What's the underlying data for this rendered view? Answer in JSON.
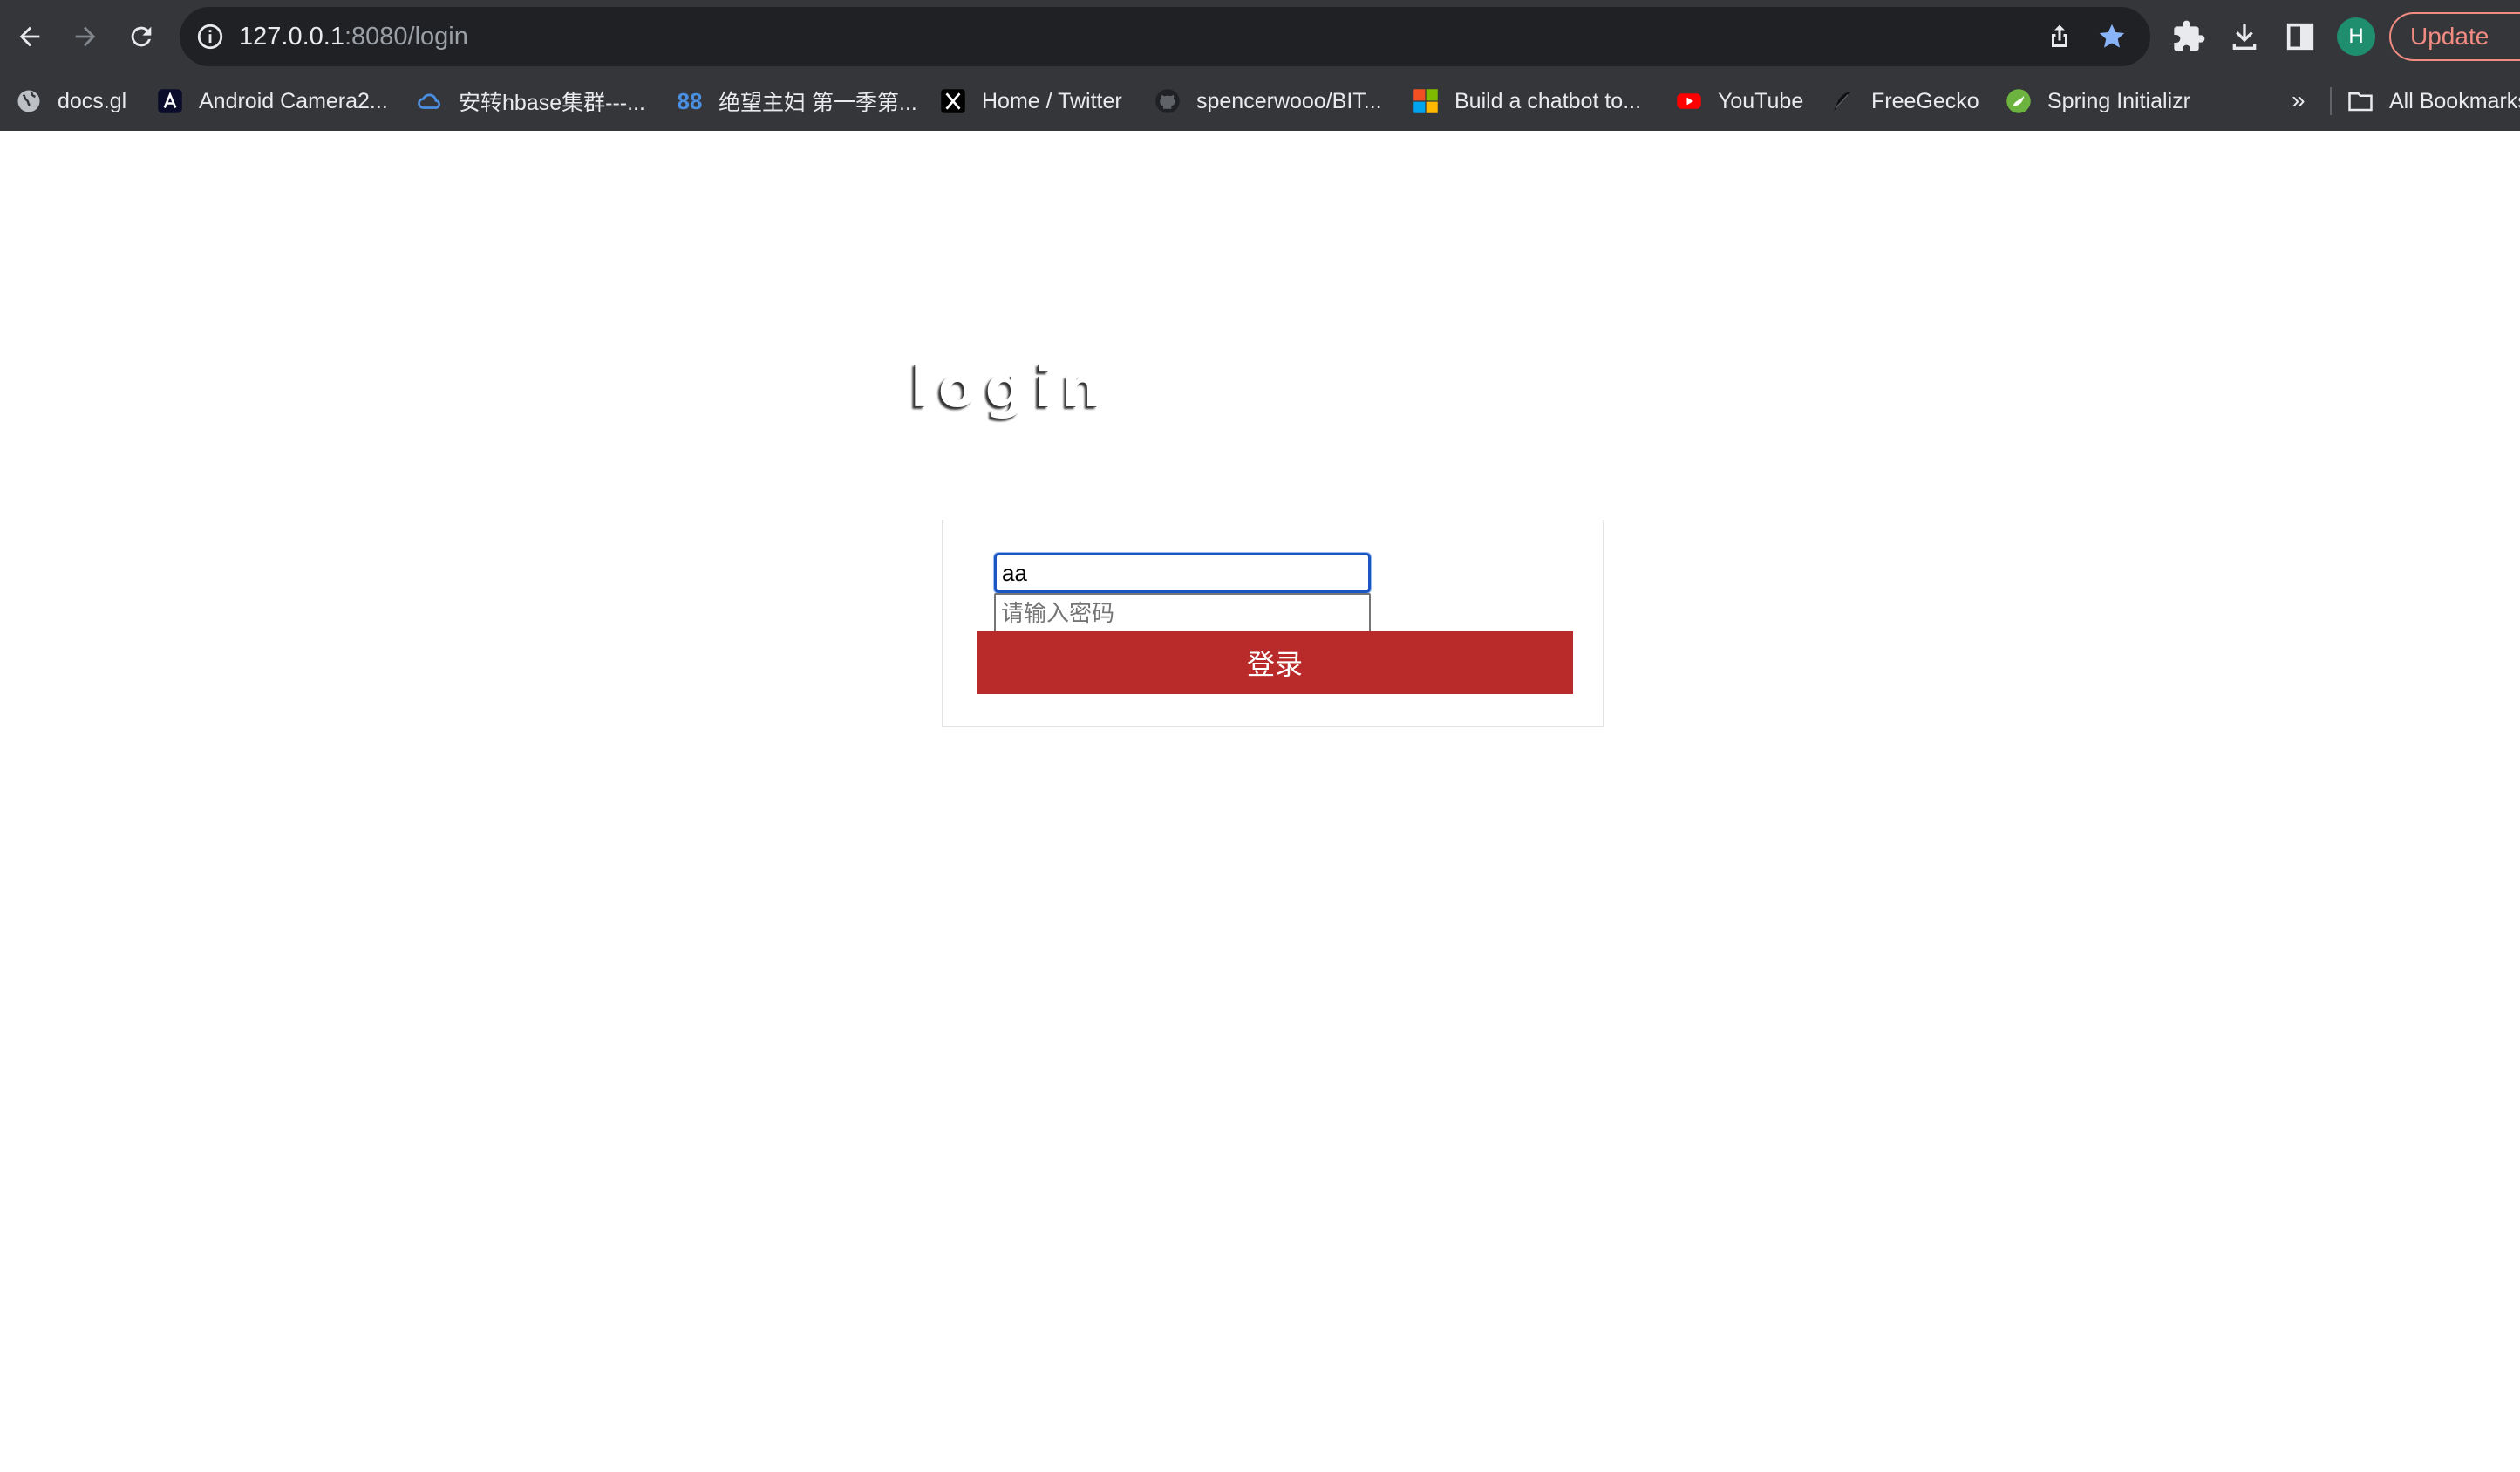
{
  "browser": {
    "url_host": "127.0.0.1",
    "url_rest": ":8080/login",
    "update_label": "Update",
    "profile_initial": "H",
    "bookmarks": [
      {
        "label": "docs.gl",
        "icon": "globe-icon"
      },
      {
        "label": "Android Camera2...",
        "icon": "android-studio-icon"
      },
      {
        "label": "安转hbase集群---...",
        "icon": "cloud-icon"
      },
      {
        "label": "绝望主妇 第一季第...",
        "icon": "88-icon"
      },
      {
        "label": "Home / Twitter",
        "icon": "x-icon"
      },
      {
        "label": "spencerwooo/BIT...",
        "icon": "github-icon"
      },
      {
        "label": "Build a chatbot to...",
        "icon": "microsoft-icon"
      },
      {
        "label": "YouTube",
        "icon": "youtube-icon"
      },
      {
        "label": "FreeGecko",
        "icon": "feather-icon"
      },
      {
        "label": "Spring Initializr",
        "icon": "spring-icon"
      }
    ],
    "more_bookmarks": "»",
    "all_bookmarks_label": "All Bookmarks"
  },
  "login": {
    "title": "login",
    "username_value": "aa",
    "password_placeholder": "请输入密码",
    "submit_label": "登录"
  },
  "colors": {
    "button_bg": "#b92b2b",
    "focus_ring": "#1a56c4",
    "chrome_bg": "#35363a",
    "omnibox_bg": "#202124"
  }
}
